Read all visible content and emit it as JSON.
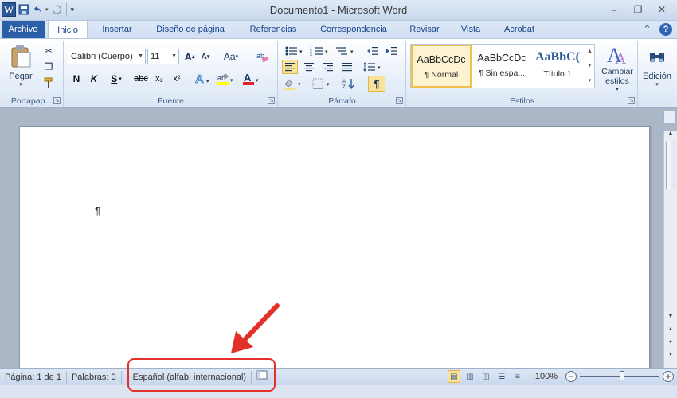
{
  "window": {
    "title": "Documento1  -  Microsoft Word",
    "app_icon_letter": "W",
    "controls": {
      "minimize": "–",
      "maximize": "❐",
      "close": "✕"
    }
  },
  "qat": {
    "save": "💾",
    "undo": "↶",
    "redo": "↻",
    "customize": "▾"
  },
  "tabs": [
    {
      "label": "Archivo"
    },
    {
      "label": "Inicio"
    },
    {
      "label": "Insertar"
    },
    {
      "label": "Diseño de página"
    },
    {
      "label": "Referencias"
    },
    {
      "label": "Correspondencia"
    },
    {
      "label": "Revisar"
    },
    {
      "label": "Vista"
    },
    {
      "label": "Acrobat"
    }
  ],
  "ribbon": {
    "clipboard": {
      "label": "Portapap...",
      "paste": "Pegar"
    },
    "font": {
      "label": "Fuente",
      "family": "Calibri (Cuerpo)",
      "size": "11",
      "bold": "N",
      "italic": "K",
      "underline": "S",
      "strike": "abc",
      "subscript": "x₂",
      "superscript": "x²",
      "grow": "A",
      "shrink": "A",
      "case": "Aa",
      "font_color": "A"
    },
    "paragraph": {
      "label": "Párrafo",
      "pilcrow": "¶"
    },
    "styles": {
      "label": "Estilos",
      "items": [
        {
          "sample": "AaBbCcDc",
          "name": "¶ Normal"
        },
        {
          "sample": "AaBbCcDc",
          "name": "¶ Sin espa..."
        },
        {
          "sample": "AaBbC(",
          "name": "Título 1"
        }
      ],
      "change": "Cambiar estilos"
    },
    "editing": {
      "label": "Edición"
    }
  },
  "document": {
    "pilcrow": "¶"
  },
  "status": {
    "page": "Página: 1 de 1",
    "words": "Palabras: 0",
    "language": "Español (alfab. internacional)",
    "zoom": "100%"
  },
  "colors": {
    "file_tab": "#2d5ea8",
    "highlight": "#e4302a",
    "selected_style": "#f2c04a"
  }
}
